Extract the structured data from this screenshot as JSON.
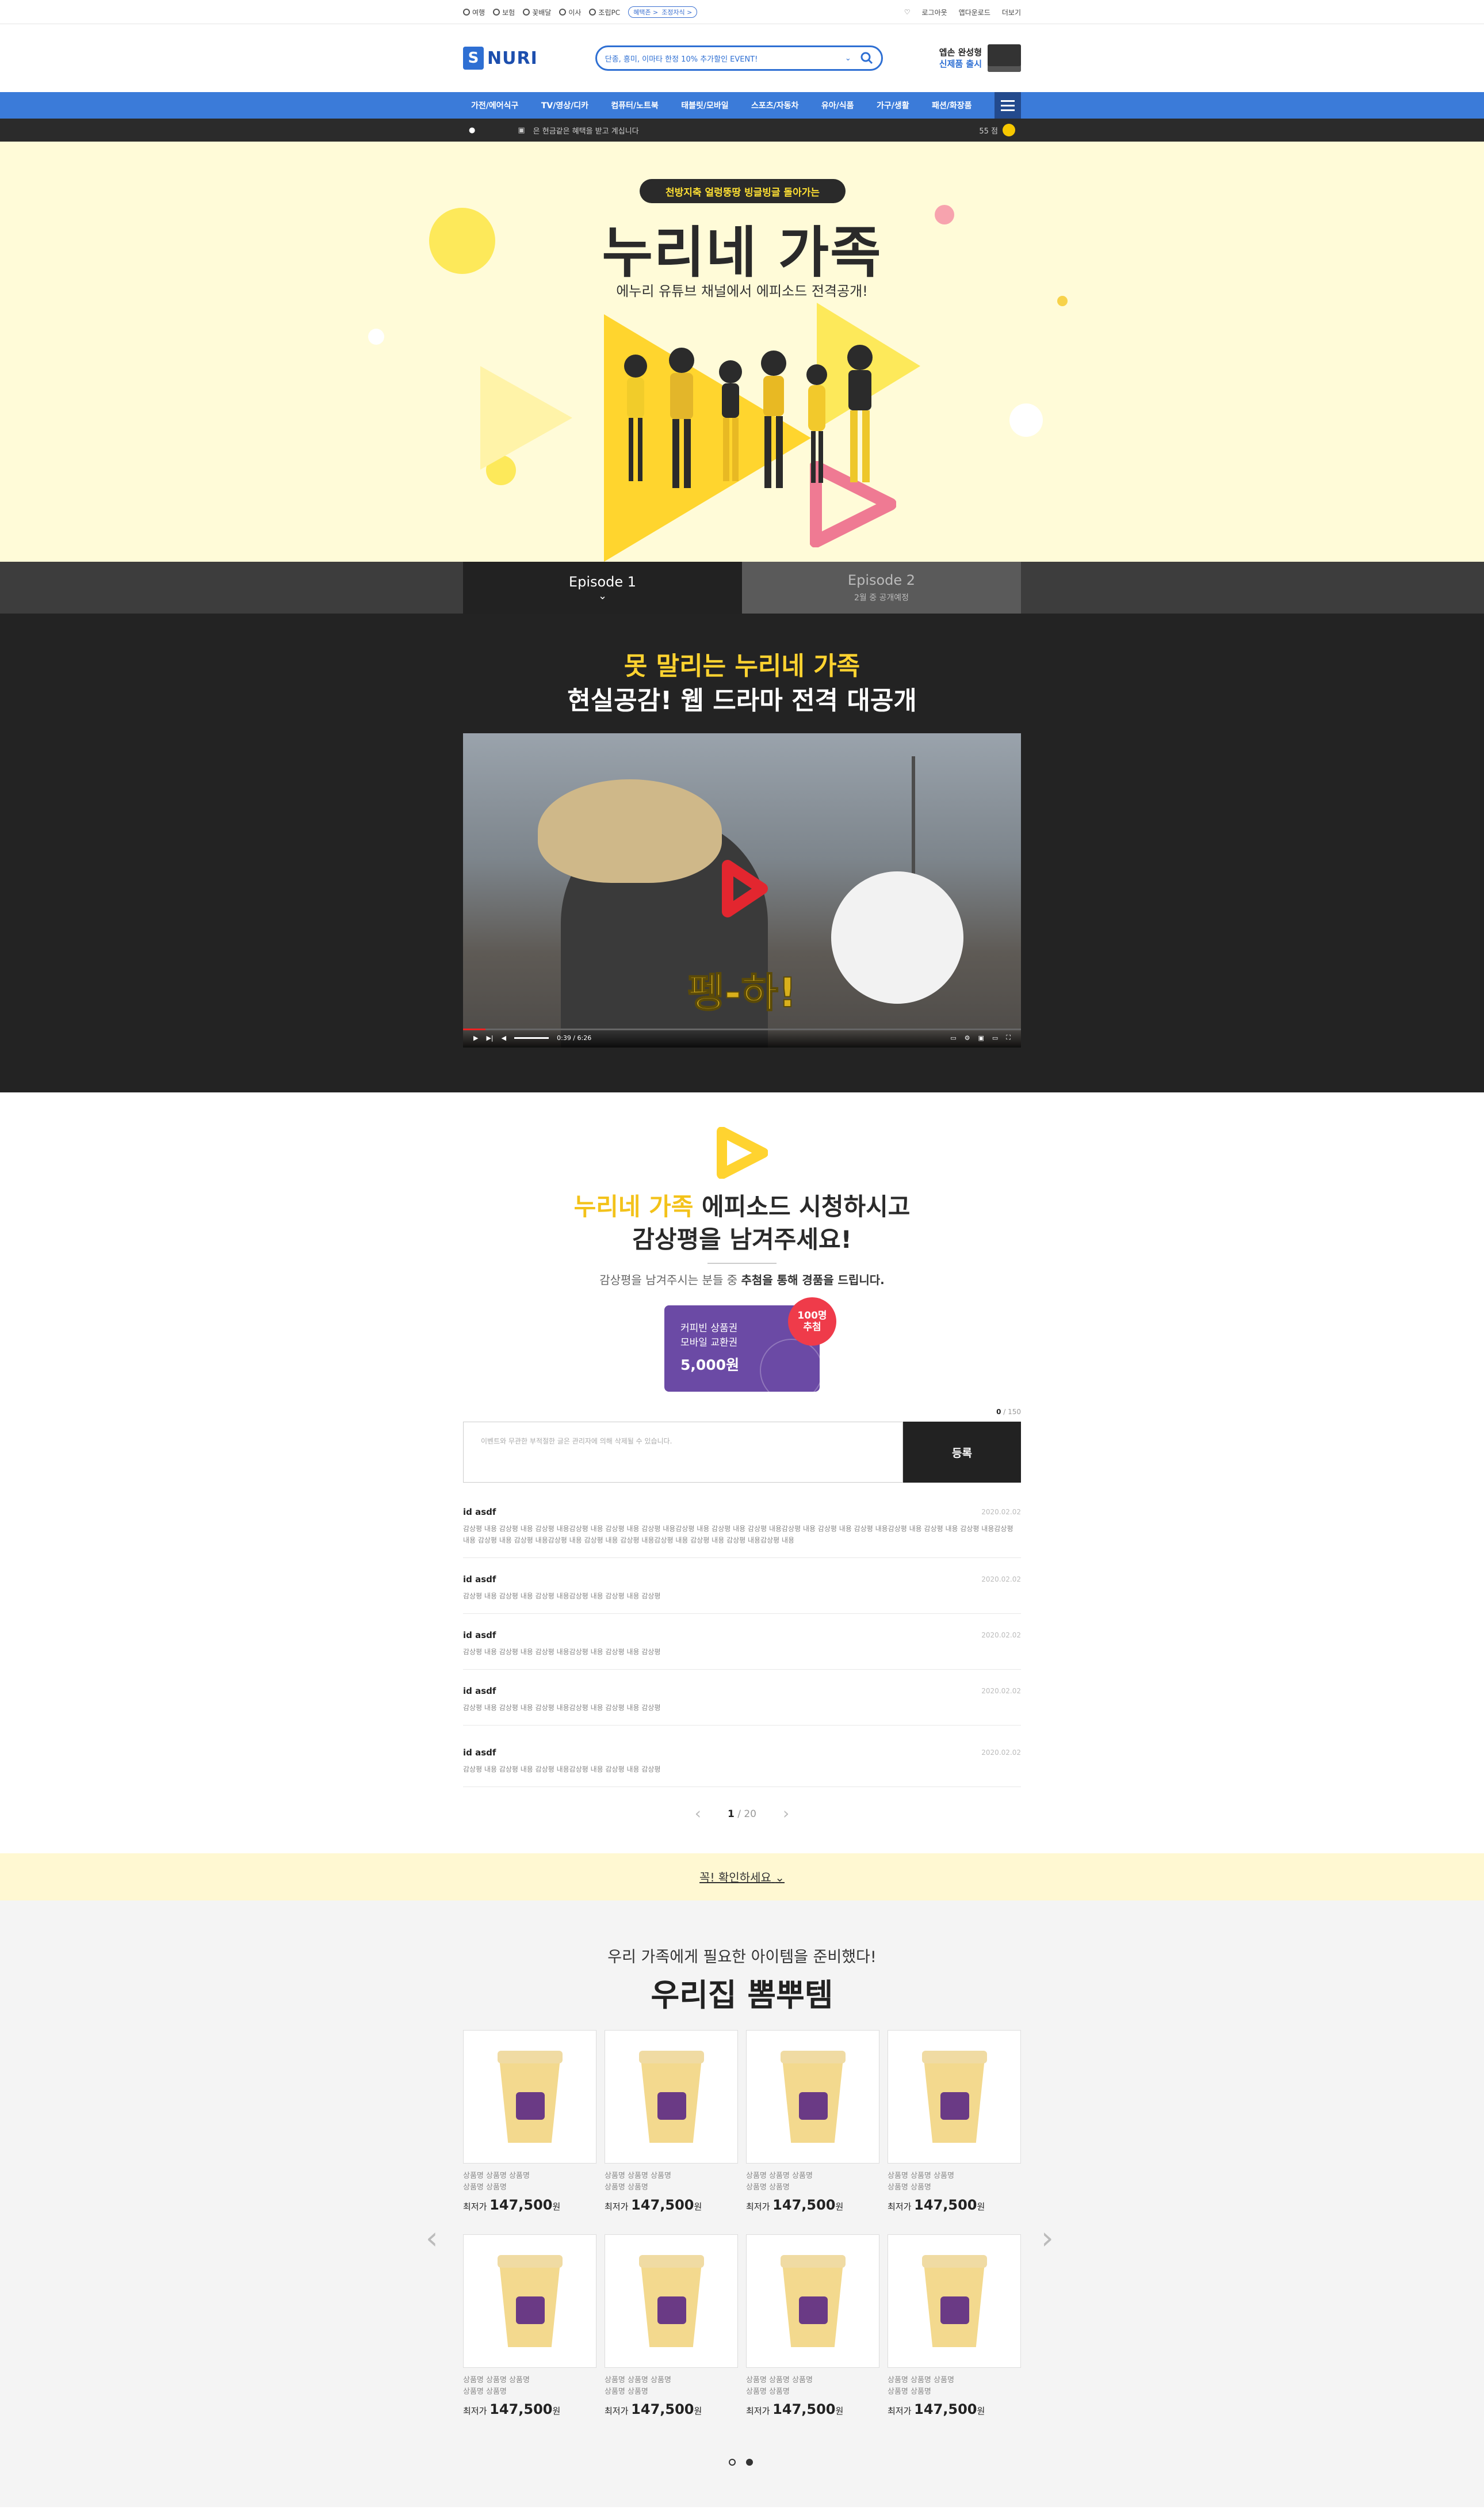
{
  "topbar": {
    "services": [
      {
        "label": "여행",
        "icon": "plane-icon"
      },
      {
        "label": "보험",
        "icon": "shield-icon"
      },
      {
        "label": "꽃배달",
        "icon": "flower-icon"
      },
      {
        "label": "이사",
        "icon": "truck-icon"
      },
      {
        "label": "조립PC",
        "icon": "pc-icon"
      }
    ],
    "pill_a": "혜택존 >",
    "pill_b": "조정자식 >",
    "util": [
      "로그아웃",
      "앱다운로드",
      "더보기"
    ]
  },
  "header": {
    "logo_mark": "S",
    "logo_text": "NURI",
    "search_placeholder": "단종, 흥미, 이마타 한정 10% 추가할인 EVENT!",
    "ad_line1": "엡손 완성형",
    "ad_line2": "신제품 출시"
  },
  "nav": {
    "items": [
      "가전/에어식구",
      "TV/영상/디카",
      "컴퓨터/노트북",
      "태블릿/모바일",
      "스포츠/자동차",
      "유아/식품",
      "가구/생활",
      "패션/화장품"
    ]
  },
  "ticker": {
    "text": "은 현금같은 혜택을 받고 계십니다",
    "right_label": "55 점"
  },
  "hero": {
    "badge": "천방지축 얼렁뚱땅 빙글빙글 돌아가는",
    "title": "누리네 가족",
    "subtitle": "에누리 유튜브 채널에서 에피소드 전격공개!"
  },
  "tabs": [
    {
      "label": "Episode 1",
      "sub": ""
    },
    {
      "label": "Episode 2",
      "sub": "2월 중 공개예정"
    }
  ],
  "video": {
    "headline1": "못 말리는 누리네 가족",
    "headline2": "현실공감! 웹 드라마 전격 대공개",
    "caption": "펭-하!",
    "time": "0:39 / 6:26"
  },
  "comments": {
    "heading_highlight": "누리네 가족",
    "heading_rest": " 에피소드 시청하시고",
    "heading2": "감상평을 남겨주세요!",
    "desc_pre": "감상평을 남겨주시는 분들 중 ",
    "desc_bold": "추첨을 통해 경품을 드립니다.",
    "coupon_line1": "커피빈 상품권",
    "coupon_line2": "모바일 교환권",
    "coupon_amount": "5,000원",
    "badge_line1": "100명",
    "badge_line2": "추첨",
    "count_now": "0",
    "count_max": " / 150",
    "input_placeholder": "이벤트와 무관한 부적절한 글은 관리자에 의해 삭제될 수 있습니다.",
    "submit": "등록",
    "items": [
      {
        "id": "id asdf",
        "date": "2020.02.02",
        "body": "감상평 내용 감상평 내용 감상평 내용감상평 내용 감상평 내용 감상평 내용감상평 내용 감상평 내용 감상평 내용감상평 내용 감상평 내용 감상평 내용감상평 내용 감상평 내용 감상평 내용감상평 내용 감상평 내용 감상평 내용감상평 내용 감상평 내용 감상평 내용감상평 내용 감상평 내용 감상평 내용감상평 내용"
      },
      {
        "id": "id asdf",
        "date": "2020.02.02",
        "body": "감상평 내용 감상평 내용 감상평 내용감상평 내용 감상평 내용 감상평"
      },
      {
        "id": "id asdf",
        "date": "2020.02.02",
        "body": "감상평 내용 감상평 내용 감상평 내용감상평 내용 감상평 내용 감상평"
      },
      {
        "id": "id asdf",
        "date": "2020.02.02",
        "body": "감상평 내용 감상평 내용 감상평 내용감상평 내용 감상평 내용 감상평"
      },
      {
        "id": "id asdf",
        "date": "2020.02.02",
        "body": "감상평 내용 감상평 내용 감상평 내용감상평 내용 감상평 내용 감상평"
      }
    ],
    "page_current": "1",
    "page_total": " / 20"
  },
  "check": {
    "label": "꼭! 확인하세요"
  },
  "products": {
    "heading1": "우리 가족에게 필요한 아이템을 준비했다!",
    "heading2": "우리집 뽐뿌템",
    "items": [
      {
        "name1": "상품명 상품명 상품명",
        "name2": "상품명 상품명",
        "price_label": "최저가 ",
        "price": "147,500",
        "unit": "원"
      },
      {
        "name1": "상품명 상품명 상품명",
        "name2": "상품명 상품명",
        "price_label": "최저가 ",
        "price": "147,500",
        "unit": "원"
      },
      {
        "name1": "상품명 상품명 상품명",
        "name2": "상품명 상품명",
        "price_label": "최저가 ",
        "price": "147,500",
        "unit": "원"
      },
      {
        "name1": "상품명 상품명 상품명",
        "name2": "상품명 상품명",
        "price_label": "최저가 ",
        "price": "147,500",
        "unit": "원"
      },
      {
        "name1": "상품명 상품명 상품명",
        "name2": "상품명 상품명",
        "price_label": "최저가 ",
        "price": "147,500",
        "unit": "원"
      },
      {
        "name1": "상품명 상품명 상품명",
        "name2": "상품명 상품명",
        "price_label": "최저가 ",
        "price": "147,500",
        "unit": "원"
      },
      {
        "name1": "상품명 상품명 상품명",
        "name2": "상품명 상품명",
        "price_label": "최저가 ",
        "price": "147,500",
        "unit": "원"
      },
      {
        "name1": "상품명 상품명 상품명",
        "name2": "상품명 상품명",
        "price_label": "최저가 ",
        "price": "147,500",
        "unit": "원"
      }
    ]
  },
  "colors": {
    "brand": "#2e6fd3",
    "nav": "#3b7bd9",
    "yellow": "#ffd330",
    "hero_bg": "#fffbd8",
    "coupon": "#6b4aa5",
    "badge": "#ef3b4a"
  }
}
